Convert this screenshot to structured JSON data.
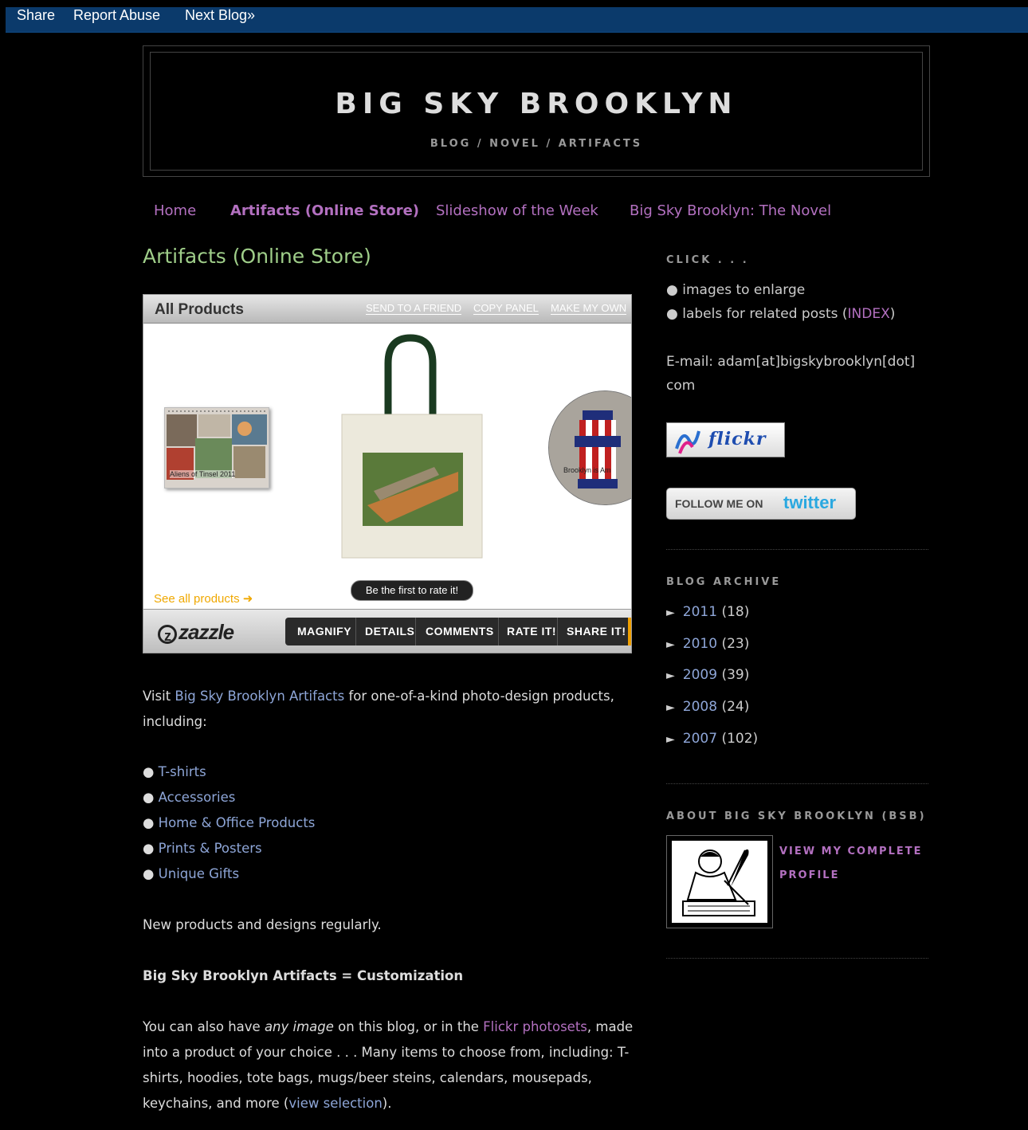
{
  "navbar": {
    "share": "Share",
    "report_abuse": "Report Abuse",
    "next_blog": "Next Blog»"
  },
  "header": {
    "title": "BIG SKY BROOKLYN",
    "description": "BLOG / NOVEL / ARTIFACTS"
  },
  "tabs": [
    {
      "label": "Home"
    },
    {
      "label": "Artifacts (Online Store)"
    },
    {
      "label": "Slideshow of the Week"
    },
    {
      "label": "Big Sky Brooklyn: The Novel"
    }
  ],
  "post": {
    "title": "Artifacts (Online Store)",
    "widget": {
      "header": "All Products",
      "links": [
        "SEND TO A FRIEND",
        "COPY PANEL",
        "MAKE MY OWN"
      ],
      "calendar_caption": "Aliens of Tinsel 2011",
      "hydrant_caption": "Brooklyn is Am",
      "rate_label": "Be the first to rate it!",
      "see_all": "See all products ➜",
      "logo": "zazzle",
      "buttons": [
        "MAGNIFY",
        "DETAILS",
        "COMMENTS",
        "RATE IT!",
        "SHARE IT!"
      ]
    },
    "p1_before": "Visit ",
    "p1_link": "Big Sky Brooklyn Artifacts",
    "p1_after": " for one-of-a-kind photo-design products, including:",
    "list": [
      "T-shirts",
      "Accessories",
      "Home & Office Products",
      "Prints & Posters",
      "Unique Gifts"
    ],
    "p2": "New products and designs regularly.",
    "p3": "Big Sky Brooklyn Artifacts = Customization",
    "p4_a": "You can also have ",
    "p4_em": "any image",
    "p4_b": " on this blog, or in the ",
    "p4_link": "Flickr photosets",
    "p4_c": ", made into a product of your choice . . . Many items to choose from, including: T-shirts, hoodies, tote bags, mugs/beer steins, calendars, mousepads, keychains, and more (",
    "p4_link2": "view selection",
    "p4_d": ")."
  },
  "sidebar": {
    "click_heading": "CLICK . . .",
    "click_item1": "● images to enlarge",
    "click_item2_a": "● labels for related posts (",
    "click_item2_link": "INDEX",
    "click_item2_b": ")",
    "email_line1": "E-mail: adam[at]bigskybrooklyn[dot]",
    "email_line2": "com",
    "flickr_label": "flickr",
    "twitter_prefix": "FOLLOW ME ON",
    "twitter_word": "twitter",
    "archive_heading": "BLOG ARCHIVE",
    "archive": [
      {
        "year": "2011",
        "count": "(18)"
      },
      {
        "year": "2010",
        "count": "(23)"
      },
      {
        "year": "2009",
        "count": "(39)"
      },
      {
        "year": "2008",
        "count": "(24)"
      },
      {
        "year": "2007",
        "count": "(102)"
      }
    ],
    "about_heading": "ABOUT BIG SKY BROOKLYN (BSB)",
    "profile_link": "VIEW MY COMPLETE PROFILE"
  }
}
